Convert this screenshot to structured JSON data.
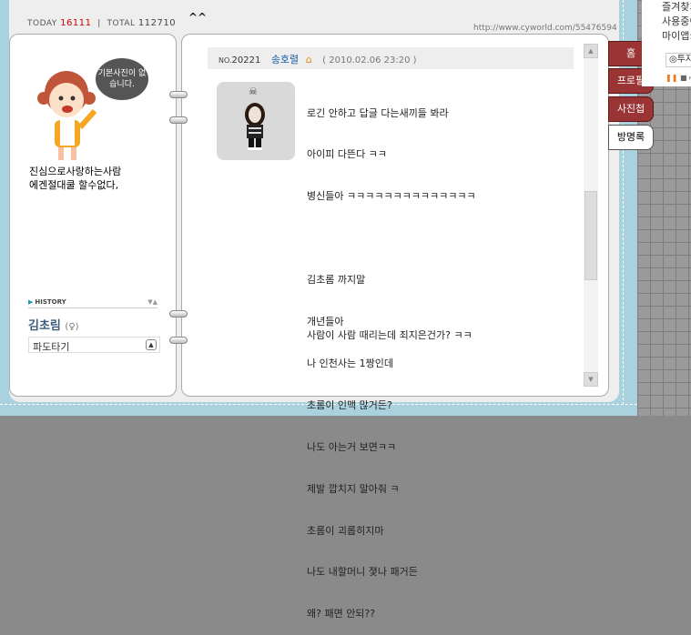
{
  "counter": {
    "today_label": "TODAY",
    "today": "16111",
    "total_label": "TOTAL",
    "total": "112710"
  },
  "caret": "^^",
  "url": "http://www.cyworld.com/55476594",
  "profile": {
    "bubble": "기본사진이 없습니다.",
    "motto_line1": "진심으로사랑하는사람",
    "motto_line2": "에겐절대쿨 할수없다,",
    "history_label": "HISTORY",
    "name": "김초림",
    "gender": "(♀)",
    "select_value": "파도타기"
  },
  "entry": {
    "no_label": "NO.",
    "number": "20221",
    "author": "송호렬",
    "date": "( 2010.02.06 23:20 )",
    "lines": [
      "로긴 안하고 답글 다는새끼들 봐라",
      "아이피 다뜬다 ㅋㅋ",
      "병신들아 ㅋㅋㅋㅋㅋㅋㅋㅋㅋㅋㅋㅋㅋㅋ",
      "",
      "김초롬 까지말",
      "개년들아",
      "나 인천사는 1짱인데",
      "초롬이 인맥 많거든?",
      "나도 아는거 보면ㅋㅋ",
      "제발 깝치지 말아줘 ㅋ",
      "초롬이 괴롭히지마",
      "나도 내할머니 졏나 패거든",
      "왜? 패면 안되??"
    ],
    "extra": "사람이 사람 때리는데 죄지은건가? ㅋㅋ"
  },
  "tabs": [
    {
      "label": "홈"
    },
    {
      "label": "프로필"
    },
    {
      "label": "사진첩"
    },
    {
      "label": "방명록"
    }
  ],
  "side": {
    "line1": "즐겨찾기",
    "line2": "사용중이",
    "line3": "마이앱:",
    "player": "투자"
  }
}
